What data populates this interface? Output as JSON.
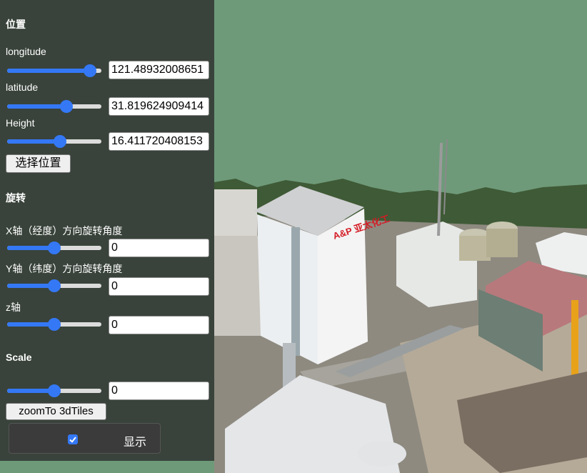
{
  "panel": {
    "position": {
      "title": "位置",
      "longitude": {
        "label": "longitude",
        "value": "121.48932008651",
        "slider_level": 0.94
      },
      "latitude": {
        "label": "latitude",
        "value": "31.819624909414",
        "slider_level": 0.65
      },
      "height": {
        "label": "Height",
        "value": "16.411720408153",
        "slider_level": 0.57
      },
      "select_button": "选择位置"
    },
    "rotation": {
      "title": "旋转",
      "x": {
        "label": "X轴（经度）方向旋转角度",
        "value": "0",
        "slider_level": 0.5
      },
      "y": {
        "label": "Y轴（纬度）方向旋转角度",
        "value": "0",
        "slider_level": 0.5
      },
      "z": {
        "label": "z轴",
        "value": "0",
        "slider_level": 0.5
      }
    },
    "scale": {
      "title": "Scale",
      "value": "0",
      "slider_level": 0.5,
      "zoom_button": "zoomTo 3dTiles"
    },
    "visibility": {
      "label": "显示",
      "checked": true
    }
  },
  "scene": {
    "sky_color": "#6e9a79",
    "building_sign": "A&P 亚太化工"
  },
  "colors": {
    "accent": "#3478f6",
    "panel_bg": "rgba(42,42,42,0.78)"
  }
}
